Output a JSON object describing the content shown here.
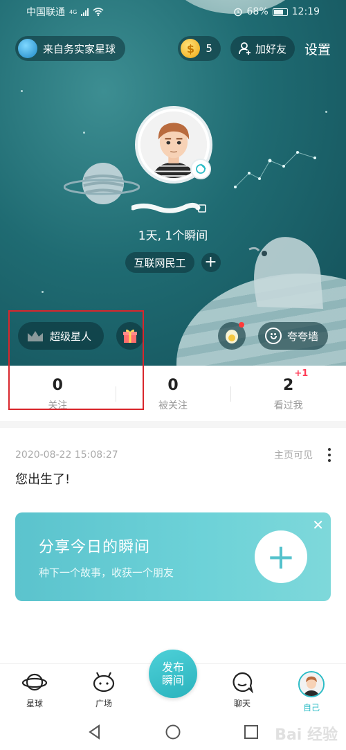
{
  "status_bar": {
    "carrier": "中国联通",
    "network": "4G",
    "battery": "68%",
    "time": "12:19",
    "icons": [
      "signal-icon",
      "wifi-icon",
      "alarm-icon",
      "battery-icon"
    ]
  },
  "header": {
    "home_planet": "来自务实家星球",
    "coins": "5",
    "add_friend": "加好友",
    "settings": "设置"
  },
  "profile": {
    "stats_line": "1天, 1个瞬间",
    "tag": "互联网民工",
    "add_tag": "+"
  },
  "actions": {
    "super_star": "超级星人",
    "praise_wall": "夸夸墙"
  },
  "counters": [
    {
      "value": "0",
      "label": "关注"
    },
    {
      "value": "0",
      "label": "被关注"
    },
    {
      "value": "2",
      "label": "看过我",
      "badge": "+1"
    }
  ],
  "post": {
    "date": "2020-08-22 15:08:27",
    "visibility": "主页可见",
    "body": "您出生了!"
  },
  "share_card": {
    "title": "分享今日的瞬间",
    "subtitle": "种下一个故事，收获一个朋友",
    "plus": "+",
    "close": "✕"
  },
  "tabbar": {
    "items": [
      {
        "label": "星球",
        "icon": "planet-icon"
      },
      {
        "label": "广场",
        "icon": "square-icon"
      },
      {
        "label": "聊天",
        "icon": "chat-icon"
      },
      {
        "label": "自己",
        "icon": "avatar-icon"
      }
    ],
    "publish": "发布瞬间",
    "active": "自己"
  },
  "watermark": "Bai 经验",
  "colors": {
    "accent": "#2bbcc6",
    "hero_dark": "#134f58",
    "badge_red": "#ff3a55",
    "highlight": "#d9262c"
  }
}
